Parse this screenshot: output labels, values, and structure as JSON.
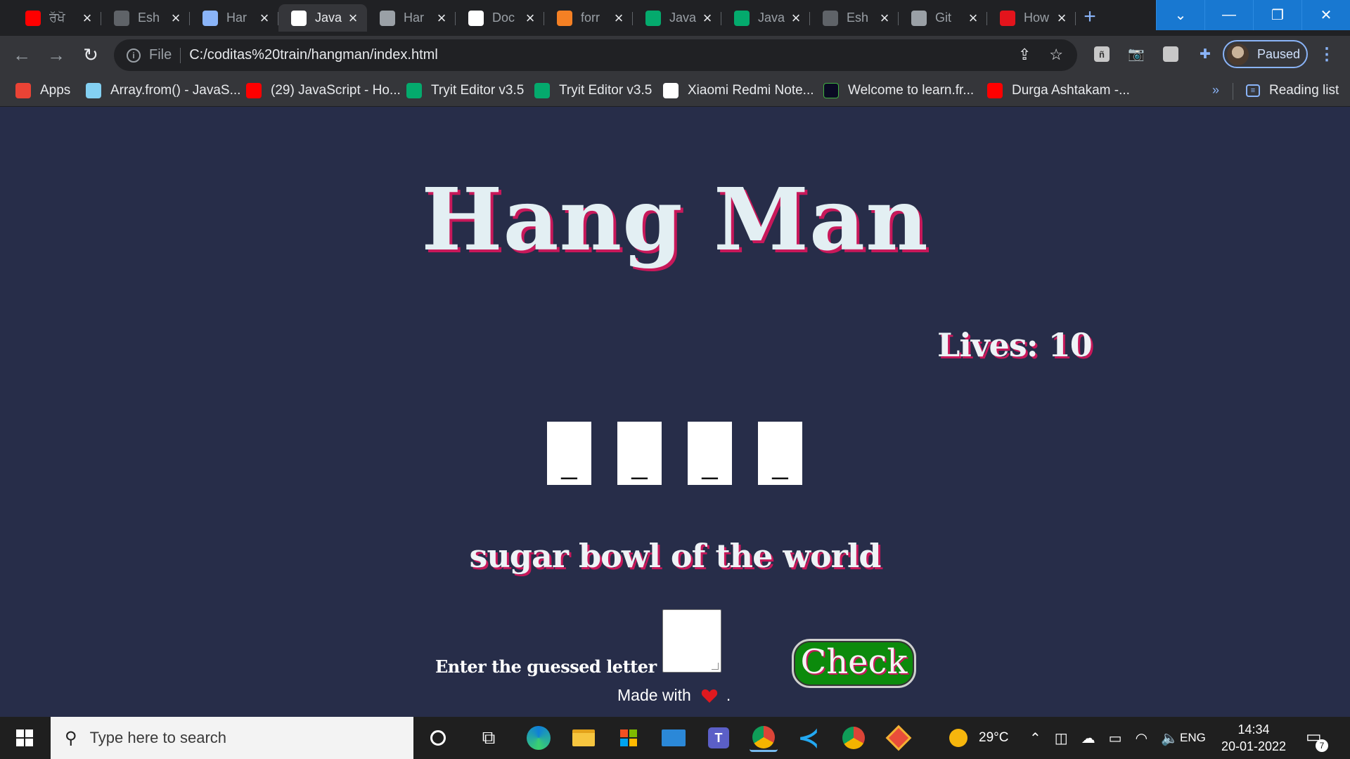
{
  "browser": {
    "tabs": [
      {
        "title": "ਰੱਖੋ",
        "icon": "youtube-icon",
        "color": "#ff0000"
      },
      {
        "title": "Esh",
        "icon": "github-icon",
        "color": "#5f6368"
      },
      {
        "title": "Har",
        "icon": "translate-icon",
        "color": "#8ab4f8"
      },
      {
        "title": "Java",
        "icon": "codepen-icon",
        "color": "#ffffff",
        "active": true
      },
      {
        "title": "Har",
        "icon": "globe-icon",
        "color": "#9aa0a6"
      },
      {
        "title": "Doc",
        "icon": "docs-icon",
        "color": "#ffffff"
      },
      {
        "title": "forr",
        "icon": "stackoverflow-icon",
        "color": "#f48024"
      },
      {
        "title": "Java",
        "icon": "w3schools-icon",
        "color": "#04aa6d"
      },
      {
        "title": "Java",
        "icon": "w3schools-icon",
        "color": "#04aa6d"
      },
      {
        "title": "Esh",
        "icon": "github-icon",
        "color": "#5f6368"
      },
      {
        "title": "Git",
        "icon": "globe-icon",
        "color": "#9aa0a6"
      },
      {
        "title": "How",
        "icon": "pcmag-icon",
        "color": "#e3141c"
      }
    ],
    "url_scheme": "File",
    "url": "C:/coditas%20train/hangman/index.html",
    "profile_label": "Paused",
    "reading_list_label": "Reading list",
    "bookmarks": [
      {
        "label": "Apps",
        "icon": "apps-grid-icon"
      },
      {
        "label": "Array.from() - JavaS...",
        "icon": "mdn-icon"
      },
      {
        "label": "(29) JavaScript - Ho...",
        "icon": "youtube-icon"
      },
      {
        "label": "Tryit Editor v3.5",
        "icon": "w3schools-icon"
      },
      {
        "label": "Tryit Editor v3.5",
        "icon": "w3schools-icon"
      },
      {
        "label": "Xiaomi Redmi Note...",
        "icon": "amazon-icon"
      },
      {
        "label": "Welcome to learn.fr...",
        "icon": "learn-icon"
      },
      {
        "label": "Durga Ashtakam -...",
        "icon": "youtube-icon"
      }
    ]
  },
  "game": {
    "title": "Hang Man",
    "lives_label": "Lives: 10",
    "lives": 10,
    "slots": [
      "_",
      "_",
      "_",
      "_"
    ],
    "hint": "sugar bowl of the world",
    "guess_label": "Enter the guessed letter",
    "guess_value": "",
    "check_label": "Check",
    "footer_text": "Made with",
    "footer_dot": ".",
    "colors": {
      "background": "#272d49",
      "accent_shadow": "#c8185a",
      "check_button": "#0c8a0c"
    }
  },
  "taskbar": {
    "search_placeholder": "Type here to search",
    "weather": "29°C",
    "language": "ENG",
    "time": "14:34",
    "date": "20-01-2022",
    "notification_count": "7"
  }
}
